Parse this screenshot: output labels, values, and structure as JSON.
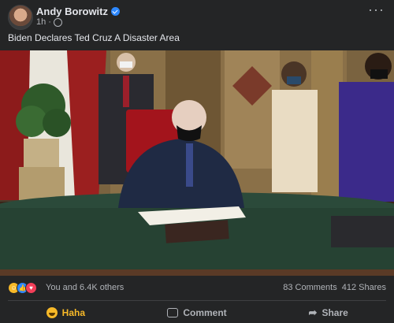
{
  "post": {
    "author": "Andy Borowitz",
    "time": "1h",
    "separator": "·",
    "caption": "Biden Declares Ted Cruz A Disaster Area",
    "more_label": "···"
  },
  "reactions": {
    "icons": [
      "haha-icon",
      "like-icon",
      "love-icon"
    ],
    "summary": "You and 6.4K others",
    "comments": "83 Comments",
    "shares": "412 Shares"
  },
  "actions": {
    "haha": "Haha",
    "comment": "Comment",
    "share": "Share"
  },
  "colors": {
    "background": "#242526",
    "text": "#e4e6eb",
    "muted": "#b0b3b8",
    "haha_active": "#f7b928",
    "verified": "#2d88ff"
  }
}
